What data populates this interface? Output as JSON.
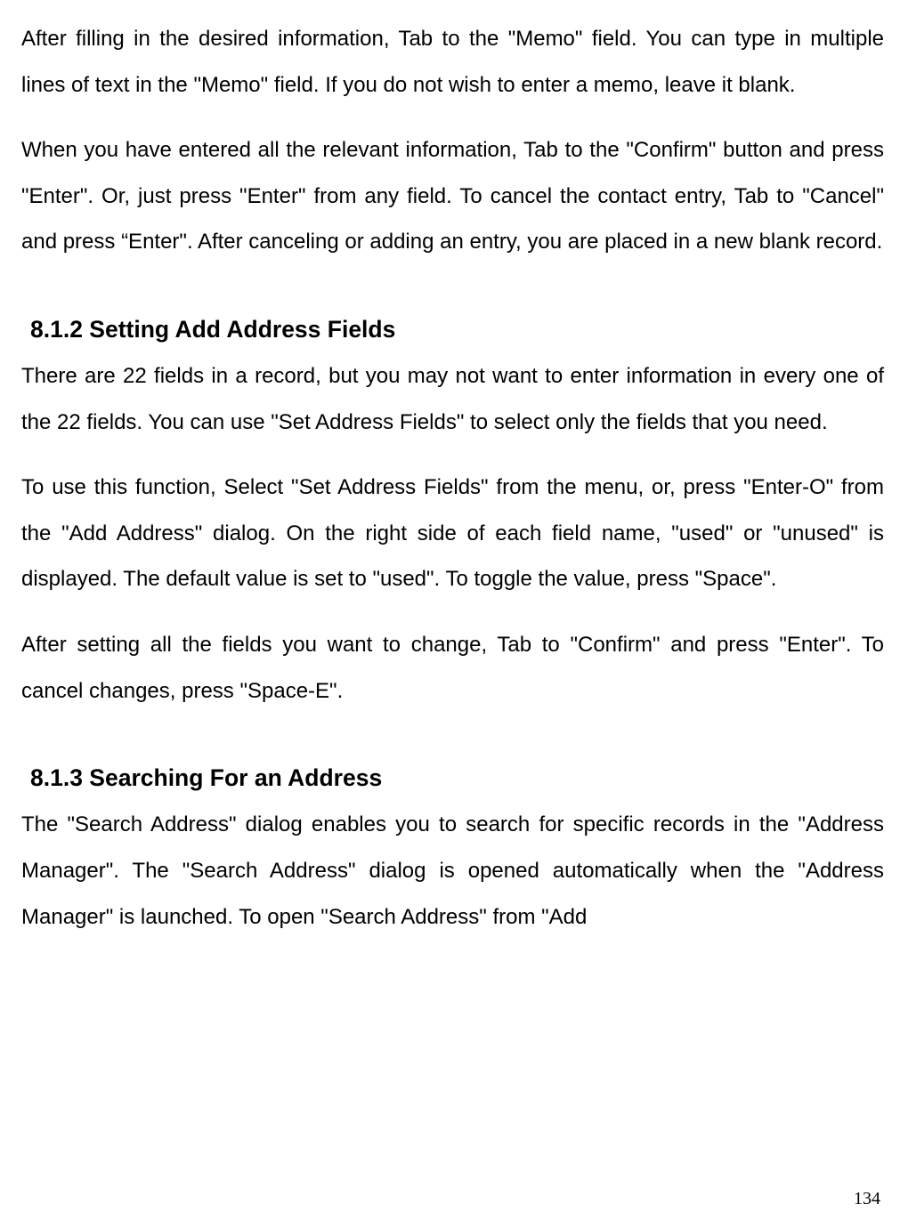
{
  "paragraphs": {
    "p1": "After filling in the desired information, Tab to the \"Memo\" field. You can type in multiple lines of text in the \"Memo\" field. If you do not wish to enter a memo, leave it blank.",
    "p2": "When you have entered all the relevant information, Tab to the \"Confirm\" button and press \"Enter\". Or, just press \"Enter\" from any field. To cancel the contact entry, Tab to \"Cancel\" and press “Enter\". After canceling or adding an entry, you are placed in a new blank record.",
    "p3": "There are 22 fields in a record, but you may not want to enter information in every one of the 22 fields. You can use \"Set Address Fields\" to select only the fields that you need.",
    "p4": "To use this function, Select \"Set Address Fields\" from the menu, or, press \"Enter-O\" from the \"Add Address\" dialog. On the right side of each field name, \"used\" or \"unused\" is displayed. The default value is set to \"used\". To toggle the value, press \"Space\".",
    "p5": "After setting all the fields you want to change, Tab to \"Confirm\" and press \"Enter\". To cancel changes, press \"Space-E\".",
    "p6": "The \"Search Address\" dialog enables you to search for specific records in the \"Address Manager\". The \"Search Address\" dialog is opened automatically when the \"Address Manager\" is launched. To open \"Search Address\" from \"Add"
  },
  "headings": {
    "h1": "8.1.2 Setting Add Address Fields",
    "h2": "8.1.3 Searching For an Address"
  },
  "pageNumber": "134"
}
